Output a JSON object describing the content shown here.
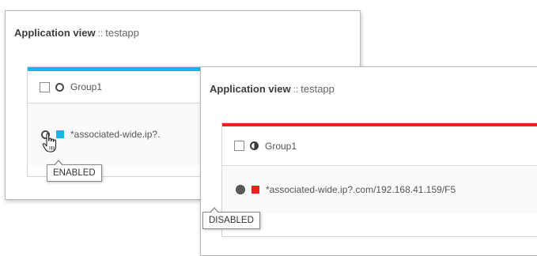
{
  "panels": [
    {
      "title": "Application view",
      "separator": "::",
      "app_name": "testapp",
      "group": {
        "name": "Group1",
        "status_icon": "ring-status-icon"
      },
      "member": {
        "label": "*associated-wide.ip?.",
        "status_icon": "ring-status-icon",
        "color": "#1eb3e6"
      },
      "accent_color": "#1eb3e6",
      "tooltip": "ENABLED"
    },
    {
      "title": "Application view",
      "separator": "::",
      "app_name": "testapp",
      "group": {
        "name": "Group1",
        "status_icon": "half-filled-status-icon"
      },
      "member": {
        "label": "*associated-wide.ip?.com/192.168.41.159/F5",
        "status_icon": "filled-dot-status-icon",
        "color": "#e8201e"
      },
      "accent_color": "#e8201e",
      "tooltip": "DISABLED"
    }
  ],
  "cursor": "hand-pointer-icon"
}
